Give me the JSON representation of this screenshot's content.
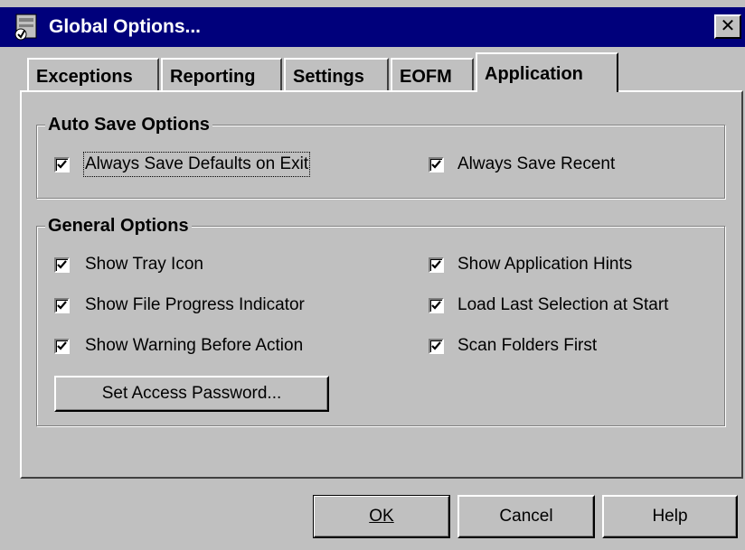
{
  "window": {
    "title": "Global Options...",
    "close_glyph": "✕"
  },
  "tabs": [
    {
      "label": "Exceptions",
      "active": false
    },
    {
      "label": "Reporting",
      "active": false
    },
    {
      "label": "Settings",
      "active": false
    },
    {
      "label": "EOFM",
      "active": false
    },
    {
      "label": "Application",
      "active": true
    }
  ],
  "auto_save": {
    "label": "Auto Save Options",
    "options": [
      {
        "label": "Always Save Defaults on Exit",
        "checked": true
      },
      {
        "label": "Always Save Recent",
        "checked": true
      }
    ]
  },
  "general": {
    "label": "General Options",
    "options": [
      {
        "label": "Show Tray Icon",
        "checked": true
      },
      {
        "label": "Show Application Hints",
        "checked": true
      },
      {
        "label": "Show File Progress Indicator",
        "checked": true
      },
      {
        "label": "Load Last Selection at Start",
        "checked": true
      },
      {
        "label": "Show Warning Before Action",
        "checked": true
      },
      {
        "label": "Scan Folders First",
        "checked": true
      }
    ],
    "password_button": "Set Access Password..."
  },
  "buttons": {
    "ok": "OK",
    "cancel": "Cancel",
    "help": "Help"
  },
  "colors": {
    "titlebar": "#00007b",
    "face": "#c0c0c0"
  }
}
